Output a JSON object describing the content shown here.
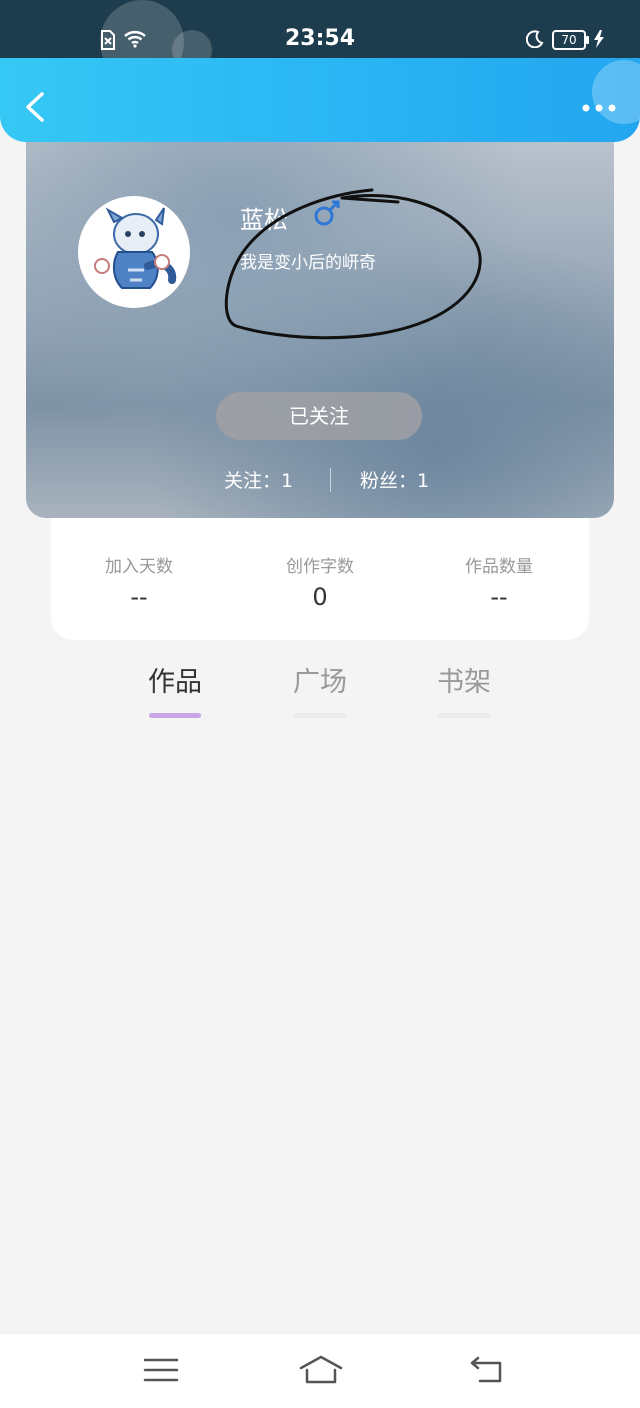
{
  "status_bar": {
    "time": "23:54",
    "battery": "70"
  },
  "profile": {
    "name": "蓝松",
    "bio": "我是变小后的岍奇",
    "follow_button": "已关注",
    "following": "关注：1",
    "followers": "粉丝：1"
  },
  "info": [
    {
      "label": "加入天数",
      "value": "--"
    },
    {
      "label": "创作字数",
      "value": "0"
    },
    {
      "label": "作品数量",
      "value": "--"
    }
  ],
  "tabs": [
    {
      "label": "作品",
      "active": true
    },
    {
      "label": "广场",
      "active": false
    },
    {
      "label": "书架",
      "active": false
    }
  ],
  "colors": {
    "header_accent": "#2bb6f4",
    "active_tab_indicator": "#c9a6e6",
    "inactive_tab_indicator": "#ebebeb",
    "active_tab_text": "#333333",
    "inactive_tab_text": "#999999"
  },
  "icons": [
    "sim-no-service-icon",
    "wifi-icon",
    "moon-icon",
    "battery-icon",
    "charging-icon",
    "back-arrow-icon",
    "more-dots-icon",
    "menu-lines-icon",
    "home-icon",
    "return-icon"
  ]
}
